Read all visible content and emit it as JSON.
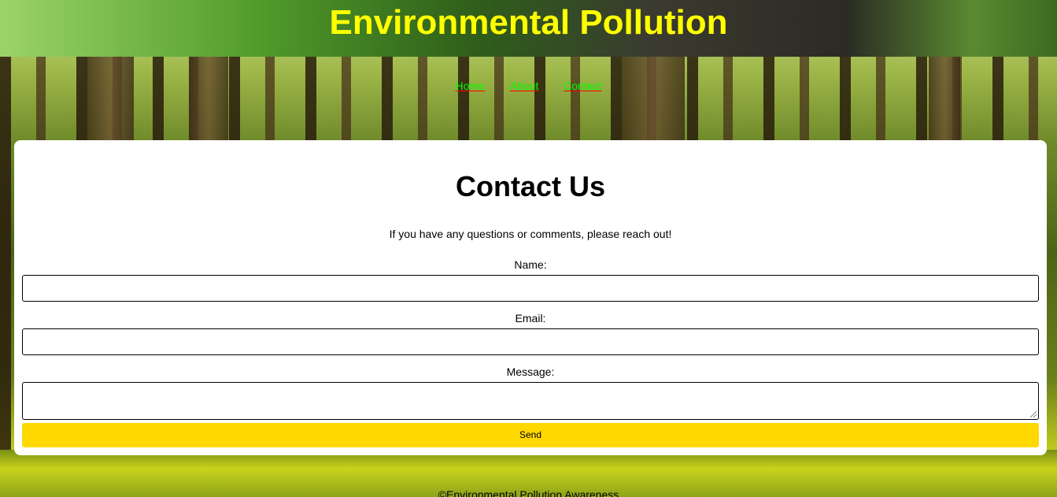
{
  "header": {
    "title": "Environmental Pollution"
  },
  "nav": {
    "items": [
      {
        "label": "Home"
      },
      {
        "label": "About"
      },
      {
        "label": "Contact"
      }
    ]
  },
  "contact": {
    "heading": "Contact Us",
    "intro": "If you have any questions or comments, please reach out!",
    "name_label": "Name:",
    "name_value": "",
    "email_label": "Email:",
    "email_value": "",
    "message_label": "Message:",
    "message_value": "",
    "send_label": "Send"
  },
  "footer": {
    "text": "©Environmental Pollution Awareness"
  },
  "colors": {
    "title": "#ffff00",
    "nav_link": "#00ff00",
    "nav_underline": "#ff0000",
    "button": "#ffd800",
    "card": "#ffffff"
  }
}
